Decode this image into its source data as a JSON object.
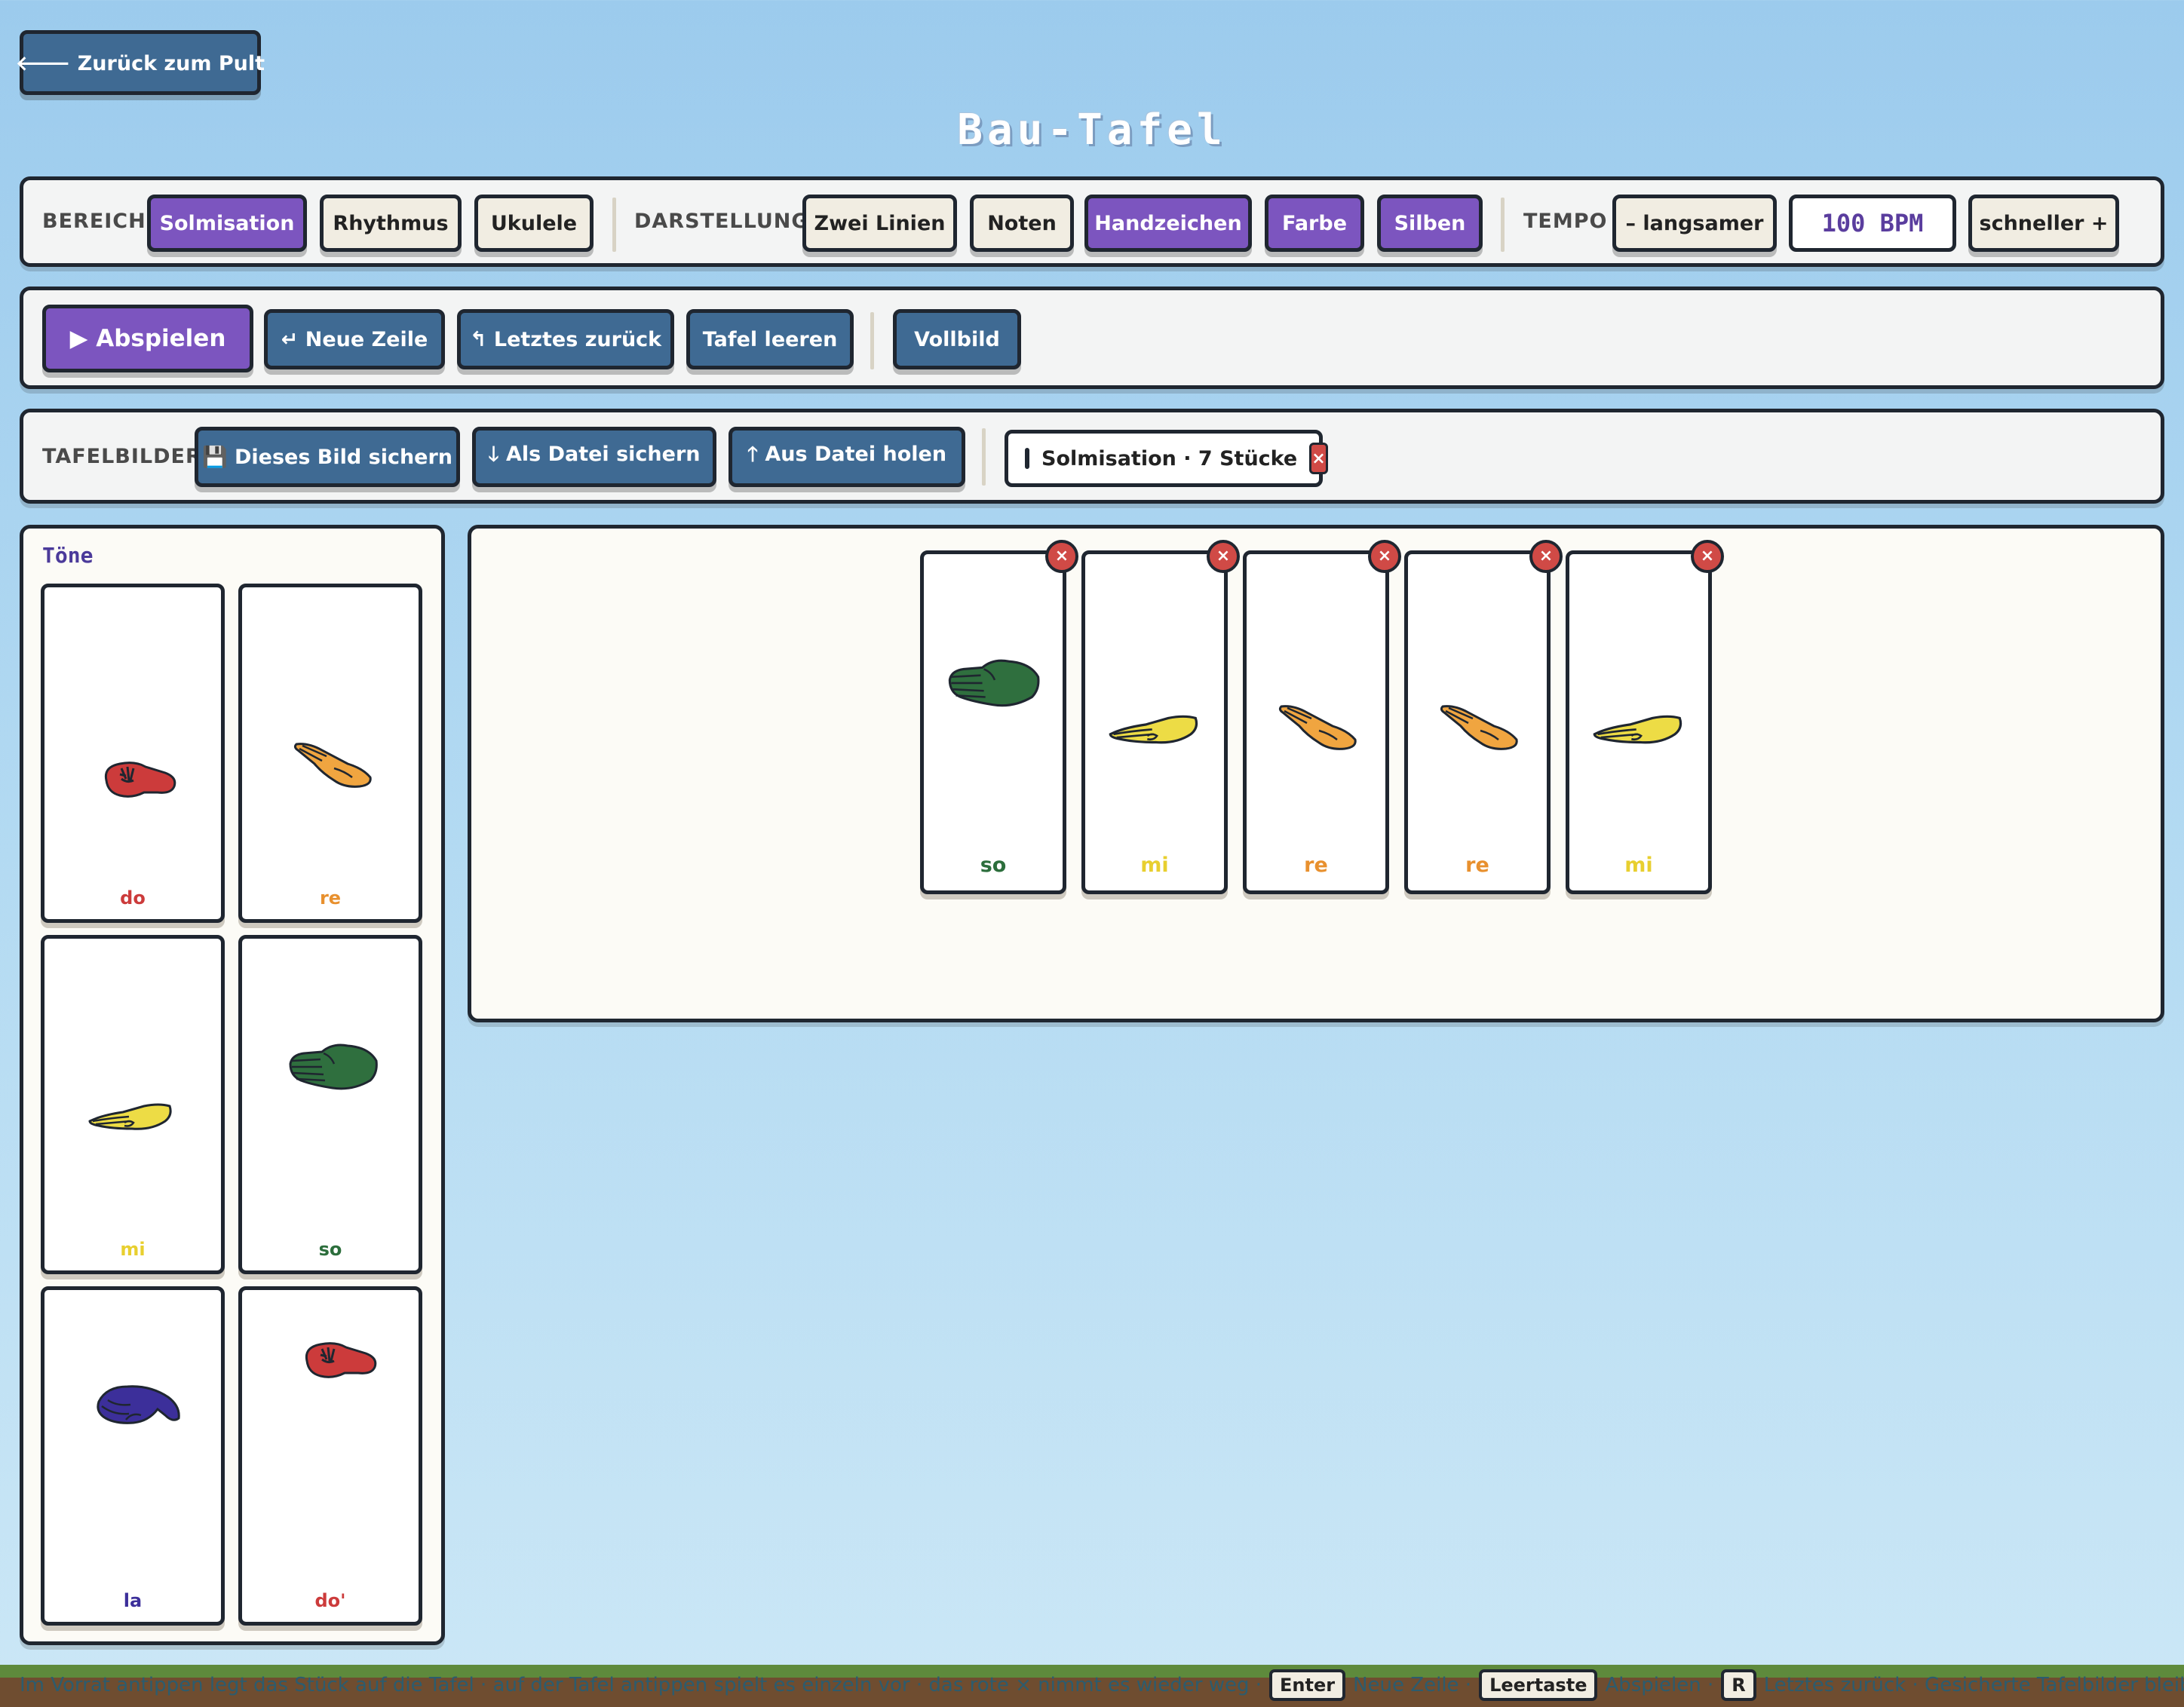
{
  "back_button": "🡐 Zurück zum Pult",
  "page_title": "Bau-Tafel",
  "settings": {
    "bereich_label": "BEREICH",
    "bereich_options": [
      "Solmisation",
      "Rhythmus",
      "Ukulele"
    ],
    "darstellung_label": "DARSTELLUNG",
    "darstellung_options": [
      "Zwei Linien",
      "Noten",
      "Handzeichen",
      "Farbe",
      "Silben"
    ],
    "tempo_label": "TEMPO",
    "tempo_slower": "– langsamer",
    "tempo_value": "100 BPM",
    "tempo_faster": "schneller +"
  },
  "actions": {
    "play": "▶ Abspielen",
    "new_line": "↵ Neue Zeile",
    "undo": "↰ Letztes zurück",
    "clear": "Tafel leeren",
    "fullscreen": "Vollbild"
  },
  "tafelbilder": {
    "label": "TAFELBILDER",
    "save_image": "💾 Dieses Bild sichern",
    "save_file": "🡓 Als Datei sichern",
    "load_file": "🡑 Aus Datei holen",
    "saved_item": "Solmisation · 7 Stücke",
    "saved_item_remove": "×"
  },
  "palette": {
    "title": "Töne",
    "tones": [
      {
        "name": "do",
        "color": "#cc3b3b",
        "hand": "fist-red"
      },
      {
        "name": "re",
        "color": "#e8902e",
        "hand": "slant-hand-orange"
      },
      {
        "name": "mi",
        "color": "#e8cf2f",
        "hand": "flat-hand-yellow"
      },
      {
        "name": "so",
        "color": "#2c6e3c",
        "hand": "side-hand-green"
      },
      {
        "name": "la",
        "color": "#3c2f9a",
        "hand": "drooping-hand-blue"
      },
      {
        "name": "do'",
        "color": "#cc3b3b",
        "hand": "fist-red"
      }
    ]
  },
  "board": {
    "cards": [
      {
        "name": "so",
        "color": "#2c6e3c",
        "remove": "×"
      },
      {
        "name": "mi",
        "color": "#e8cf2f",
        "remove": "×"
      },
      {
        "name": "re",
        "color": "#e8902e",
        "remove": "×"
      },
      {
        "name": "re",
        "color": "#e8902e",
        "remove": "×"
      },
      {
        "name": "mi",
        "color": "#e8cf2f",
        "remove": "×"
      }
    ]
  },
  "footer": {
    "text1": "Im Vorrat antippen legt das Stück auf die Tafel · auf der Tafel antippen spielt es einzeln vor · das rote × nimmt es wieder weg ·",
    "key_enter": "Enter",
    "text2": "Neue Zeile ·",
    "key_space": "Leertaste",
    "text3": "Abspielen ·",
    "key_r": "R",
    "text4": "Letztes zurück · Gesicherte Tafelbilder bleiben auf"
  }
}
